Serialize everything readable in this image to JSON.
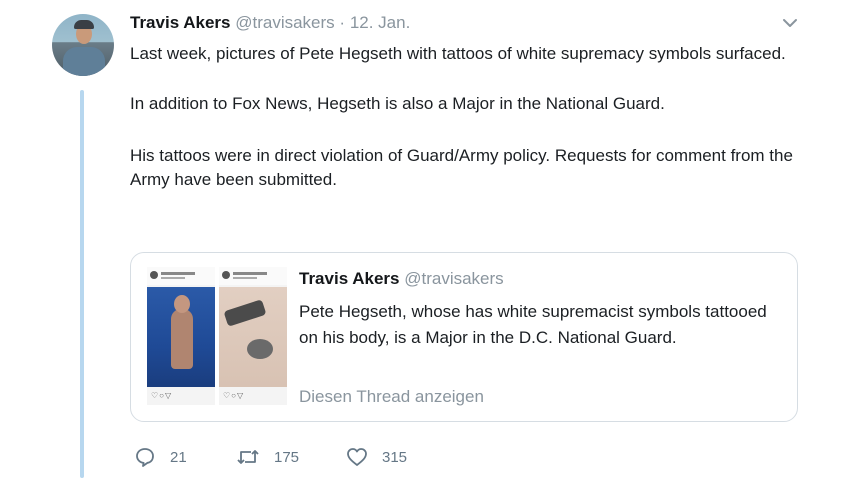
{
  "tweet": {
    "author_name": "Travis Akers",
    "author_handle": "@travisakers",
    "separator": "·",
    "date": "12. Jan.",
    "paragraphs": [
      "Last week, pictures of Pete Hegseth with tattoos of white supremacy symbols surfaced.",
      "In addition to Fox News, Hegseth is also a Major in the National Guard.",
      "His tattoos were in direct violation of Guard/Army policy. Requests for comment from the Army have been submitted."
    ]
  },
  "quoted_tweet": {
    "author_name": "Travis Akers",
    "author_handle": "@travisakers",
    "text": "Pete Hegseth, whose has white supremacist symbols tattooed on his body, is a Major in the D.C. National Guard.",
    "show_thread_link": "Diesen Thread anzeigen"
  },
  "actions": {
    "reply_count": "21",
    "retweet_count": "175",
    "like_count": "315"
  },
  "icons": {
    "menu": "chevron-down-icon",
    "reply": "reply-icon",
    "retweet": "retweet-icon",
    "like": "heart-icon"
  },
  "colors": {
    "thread_line": "#b7d7ef",
    "muted_text": "#8a959e",
    "action_text": "#657786"
  }
}
